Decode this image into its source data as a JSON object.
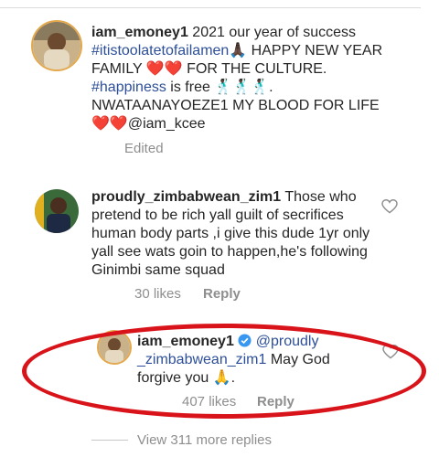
{
  "comments": [
    {
      "username": "iam_emoney1",
      "text_parts": [
        " 2021 our year of success ",
        "#itistoolatetofailamen",
        "🙏🏿 HAPPY NEW YEAR FAMILY ❤️❤️ FOR THE CULTURE. ",
        "#happiness",
        " is free 🕺🏿🕺🏿🕺🏿. NWATAANAYOEZE1 MY BLOOD FOR LIFE ❤️❤️@iam_kcee"
      ],
      "edited_label": "Edited"
    },
    {
      "username": "proudly_zimbabwean_zim1",
      "text": " Those who pretend to be rich yall guilt of secrifices human body parts ,i give this dude 1yr only yall see wats goin to happen,he's following Ginimbi same squad",
      "likes": "30 likes",
      "reply_label": "Reply"
    }
  ],
  "reply": {
    "username": "iam_emoney1",
    "mention": "@proudly _zimbabwean_zim1",
    "text": " May God forgive you 🙏.",
    "likes": "407 likes",
    "reply_label": "Reply"
  },
  "view_replies": "View 311 more replies",
  "colors": {
    "annotation_red": "#d8141a",
    "hashtag": "#2d4f99",
    "verified": "#3897f0"
  }
}
